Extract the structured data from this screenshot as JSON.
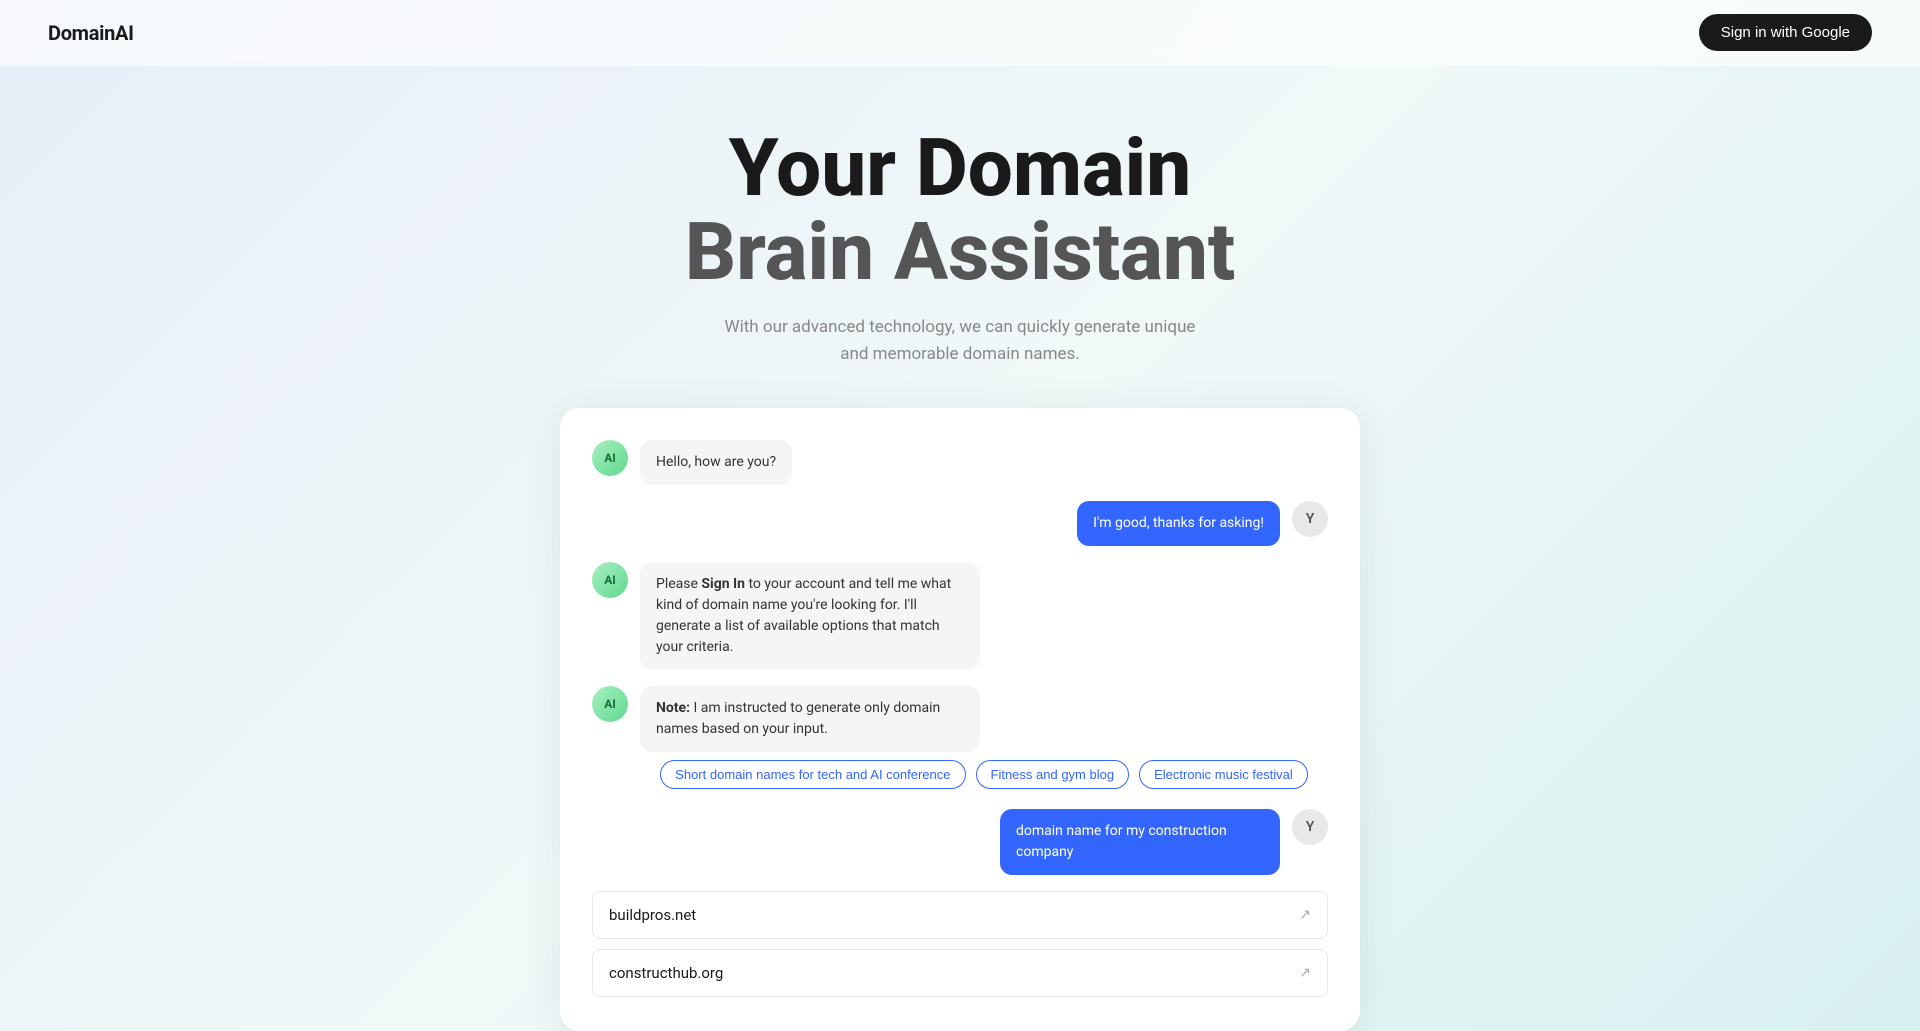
{
  "header": {
    "logo": "DomainAI",
    "sign_in_button": "Sign in with Google"
  },
  "hero": {
    "title_line1": "Your Domain",
    "title_line2": "Brain Assistant",
    "subtitle_line1": "With our advanced technology, we can quickly generate unique",
    "subtitle_line2": "and memorable domain names."
  },
  "chat": {
    "messages": [
      {
        "role": "ai",
        "avatar_label": "AI",
        "text": "Hello, how are you?"
      },
      {
        "role": "user",
        "avatar_label": "Y",
        "text": "I'm good, thanks for asking!"
      },
      {
        "role": "ai",
        "avatar_label": "AI",
        "text_parts": [
          {
            "type": "normal",
            "content": "Please "
          },
          {
            "type": "bold",
            "content": "Sign In"
          },
          {
            "type": "normal",
            "content": " to your account and tell me what kind of domain name you're looking for. I'll generate a list of available options that match your criteria."
          }
        ]
      },
      {
        "role": "ai",
        "avatar_label": "AI",
        "text_parts": [
          {
            "type": "bold",
            "content": "Note:"
          },
          {
            "type": "normal",
            "content": " I am instructed to generate only domain names based on your input."
          }
        ]
      }
    ],
    "suggestions": [
      "Short domain names for tech and AI conference",
      "Fitness and gym blog",
      "Electronic music festival"
    ],
    "user_message_2": {
      "avatar_label": "Y",
      "text": "domain name for my construction company"
    },
    "domain_results": [
      {
        "name": "buildpros.net"
      },
      {
        "name": "constructhub.org"
      }
    ]
  }
}
